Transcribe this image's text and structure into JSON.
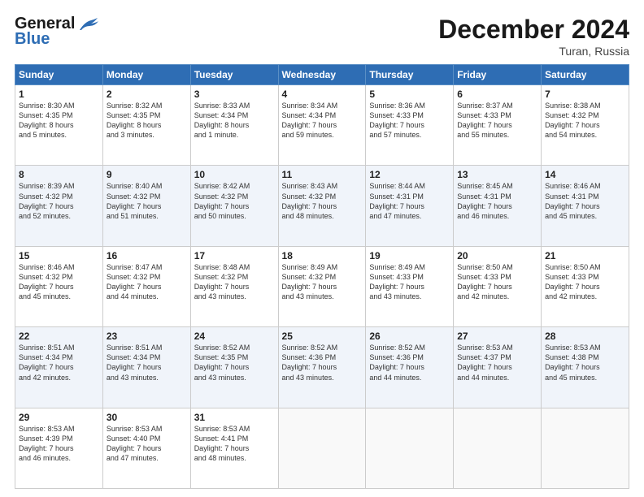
{
  "header": {
    "logo_line1": "General",
    "logo_line2": "Blue",
    "month": "December 2024",
    "location": "Turan, Russia"
  },
  "days_of_week": [
    "Sunday",
    "Monday",
    "Tuesday",
    "Wednesday",
    "Thursday",
    "Friday",
    "Saturday"
  ],
  "weeks": [
    [
      {
        "day": "1",
        "info": "Sunrise: 8:30 AM\nSunset: 4:35 PM\nDaylight: 8 hours\nand 5 minutes."
      },
      {
        "day": "2",
        "info": "Sunrise: 8:32 AM\nSunset: 4:35 PM\nDaylight: 8 hours\nand 3 minutes."
      },
      {
        "day": "3",
        "info": "Sunrise: 8:33 AM\nSunset: 4:34 PM\nDaylight: 8 hours\nand 1 minute."
      },
      {
        "day": "4",
        "info": "Sunrise: 8:34 AM\nSunset: 4:34 PM\nDaylight: 7 hours\nand 59 minutes."
      },
      {
        "day": "5",
        "info": "Sunrise: 8:36 AM\nSunset: 4:33 PM\nDaylight: 7 hours\nand 57 minutes."
      },
      {
        "day": "6",
        "info": "Sunrise: 8:37 AM\nSunset: 4:33 PM\nDaylight: 7 hours\nand 55 minutes."
      },
      {
        "day": "7",
        "info": "Sunrise: 8:38 AM\nSunset: 4:32 PM\nDaylight: 7 hours\nand 54 minutes."
      }
    ],
    [
      {
        "day": "8",
        "info": "Sunrise: 8:39 AM\nSunset: 4:32 PM\nDaylight: 7 hours\nand 52 minutes."
      },
      {
        "day": "9",
        "info": "Sunrise: 8:40 AM\nSunset: 4:32 PM\nDaylight: 7 hours\nand 51 minutes."
      },
      {
        "day": "10",
        "info": "Sunrise: 8:42 AM\nSunset: 4:32 PM\nDaylight: 7 hours\nand 50 minutes."
      },
      {
        "day": "11",
        "info": "Sunrise: 8:43 AM\nSunset: 4:32 PM\nDaylight: 7 hours\nand 48 minutes."
      },
      {
        "day": "12",
        "info": "Sunrise: 8:44 AM\nSunset: 4:31 PM\nDaylight: 7 hours\nand 47 minutes."
      },
      {
        "day": "13",
        "info": "Sunrise: 8:45 AM\nSunset: 4:31 PM\nDaylight: 7 hours\nand 46 minutes."
      },
      {
        "day": "14",
        "info": "Sunrise: 8:46 AM\nSunset: 4:31 PM\nDaylight: 7 hours\nand 45 minutes."
      }
    ],
    [
      {
        "day": "15",
        "info": "Sunrise: 8:46 AM\nSunset: 4:32 PM\nDaylight: 7 hours\nand 45 minutes."
      },
      {
        "day": "16",
        "info": "Sunrise: 8:47 AM\nSunset: 4:32 PM\nDaylight: 7 hours\nand 44 minutes."
      },
      {
        "day": "17",
        "info": "Sunrise: 8:48 AM\nSunset: 4:32 PM\nDaylight: 7 hours\nand 43 minutes."
      },
      {
        "day": "18",
        "info": "Sunrise: 8:49 AM\nSunset: 4:32 PM\nDaylight: 7 hours\nand 43 minutes."
      },
      {
        "day": "19",
        "info": "Sunrise: 8:49 AM\nSunset: 4:33 PM\nDaylight: 7 hours\nand 43 minutes."
      },
      {
        "day": "20",
        "info": "Sunrise: 8:50 AM\nSunset: 4:33 PM\nDaylight: 7 hours\nand 42 minutes."
      },
      {
        "day": "21",
        "info": "Sunrise: 8:50 AM\nSunset: 4:33 PM\nDaylight: 7 hours\nand 42 minutes."
      }
    ],
    [
      {
        "day": "22",
        "info": "Sunrise: 8:51 AM\nSunset: 4:34 PM\nDaylight: 7 hours\nand 42 minutes."
      },
      {
        "day": "23",
        "info": "Sunrise: 8:51 AM\nSunset: 4:34 PM\nDaylight: 7 hours\nand 43 minutes."
      },
      {
        "day": "24",
        "info": "Sunrise: 8:52 AM\nSunset: 4:35 PM\nDaylight: 7 hours\nand 43 minutes."
      },
      {
        "day": "25",
        "info": "Sunrise: 8:52 AM\nSunset: 4:36 PM\nDaylight: 7 hours\nand 43 minutes."
      },
      {
        "day": "26",
        "info": "Sunrise: 8:52 AM\nSunset: 4:36 PM\nDaylight: 7 hours\nand 44 minutes."
      },
      {
        "day": "27",
        "info": "Sunrise: 8:53 AM\nSunset: 4:37 PM\nDaylight: 7 hours\nand 44 minutes."
      },
      {
        "day": "28",
        "info": "Sunrise: 8:53 AM\nSunset: 4:38 PM\nDaylight: 7 hours\nand 45 minutes."
      }
    ],
    [
      {
        "day": "29",
        "info": "Sunrise: 8:53 AM\nSunset: 4:39 PM\nDaylight: 7 hours\nand 46 minutes."
      },
      {
        "day": "30",
        "info": "Sunrise: 8:53 AM\nSunset: 4:40 PM\nDaylight: 7 hours\nand 47 minutes."
      },
      {
        "day": "31",
        "info": "Sunrise: 8:53 AM\nSunset: 4:41 PM\nDaylight: 7 hours\nand 48 minutes."
      },
      {
        "day": "",
        "info": ""
      },
      {
        "day": "",
        "info": ""
      },
      {
        "day": "",
        "info": ""
      },
      {
        "day": "",
        "info": ""
      }
    ]
  ]
}
